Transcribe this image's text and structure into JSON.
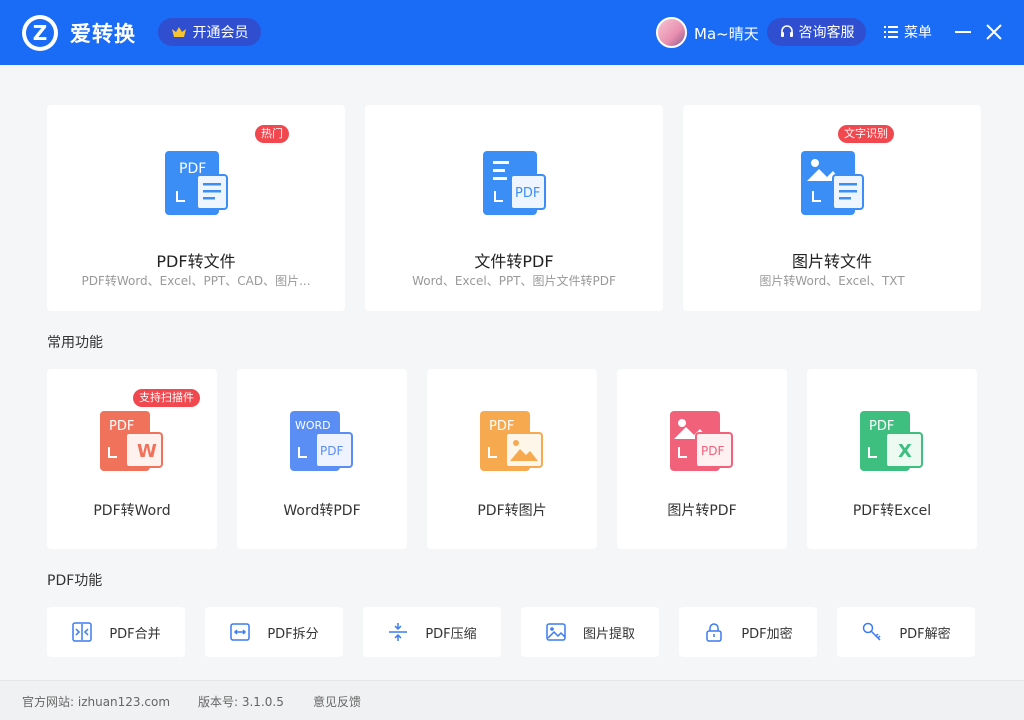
{
  "app": {
    "name": "爱转换",
    "logo_letter": "Z",
    "vip_label": "开通会员",
    "username": "Ma~晴天",
    "service_label": "咨询客服",
    "menu_label": "菜单"
  },
  "top_cards": [
    {
      "title": "PDF转文件",
      "desc": "PDF转Word、Excel、PPT、CAD、图片...",
      "badge": "热门",
      "icon_text": "PDF"
    },
    {
      "title": "文件转PDF",
      "desc": "Word、Excel、PPT、图片文件转PDF",
      "badge": "",
      "icon_text": "PDF"
    },
    {
      "title": "图片转文件",
      "desc": "图片转Word、Excel、TXT",
      "badge": "文字识别",
      "icon_text": ""
    }
  ],
  "common_section_title": "常用功能",
  "common_cards": [
    {
      "title": "PDF转Word",
      "badge": "支持扫描件",
      "icon_top": "PDF",
      "icon_bottom": "W",
      "color": "#f0725a"
    },
    {
      "title": "Word转PDF",
      "badge": "",
      "icon_top": "WORD",
      "icon_bottom": "PDF",
      "color": "#5b8ef5"
    },
    {
      "title": "PDF转图片",
      "badge": "",
      "icon_top": "PDF",
      "icon_bottom": "",
      "color": "#f6a94e"
    },
    {
      "title": "图片转PDF",
      "badge": "",
      "icon_top": "",
      "icon_bottom": "PDF",
      "color": "#f2617a"
    },
    {
      "title": "PDF转Excel",
      "badge": "",
      "icon_top": "PDF",
      "icon_bottom": "X",
      "color": "#3fbf7f"
    }
  ],
  "pdf_section_title": "PDF功能",
  "pdf_tools": [
    {
      "label": "PDF合并"
    },
    {
      "label": "PDF拆分"
    },
    {
      "label": "PDF压缩"
    },
    {
      "label": "图片提取"
    },
    {
      "label": "PDF加密"
    },
    {
      "label": "PDF解密"
    }
  ],
  "footer": {
    "website": "官方网站: izhuan123.com",
    "version": "版本号: 3.1.0.5",
    "feedback": "意见反馈"
  },
  "colors": {
    "brand": "#1a6cf6",
    "badge": "#f0484e"
  }
}
